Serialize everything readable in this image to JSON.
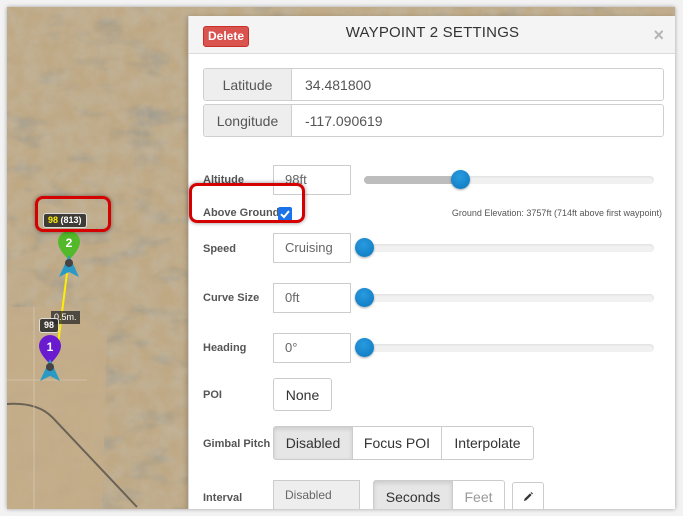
{
  "map": {
    "waypoints": [
      {
        "number": "1",
        "color": "#6a1bd0",
        "label": "98"
      },
      {
        "number": "2",
        "color": "#53b82a",
        "label_alt": "98",
        "label_ground": "(813)"
      }
    ],
    "segment_distance": "0.5m."
  },
  "panel": {
    "title": "WAYPOINT 2 SETTINGS",
    "delete_label": "Delete",
    "close_icon": "×",
    "latitude": {
      "label": "Latitude",
      "value": "34.481800"
    },
    "longitude": {
      "label": "Longitude",
      "value": "-117.090619"
    },
    "altitude": {
      "label": "Altitude",
      "value": "98ft",
      "slider_fraction": 0.33
    },
    "above_ground": {
      "label": "Above Ground",
      "checked": true
    },
    "ground_elevation": "Ground Elevation: 3757ft (714ft above first waypoint)",
    "speed": {
      "label": "Speed",
      "value": "Cruising",
      "slider_fraction": 0.0
    },
    "curve_size": {
      "label": "Curve Size",
      "value": "0ft",
      "slider_fraction": 0.0
    },
    "heading": {
      "label": "Heading",
      "value": "0°",
      "slider_fraction": 0.0
    },
    "poi": {
      "label": "POI",
      "button": "None"
    },
    "gimbal_pitch": {
      "label": "Gimbal Pitch",
      "options": [
        "Disabled",
        "Focus POI",
        "Interpolate"
      ],
      "selected": "Disabled"
    },
    "interval": {
      "label": "Interval",
      "value": "Disabled",
      "units": [
        "Seconds",
        "Feet"
      ],
      "selected_unit": "Seconds",
      "edit_icon": "pencil-icon"
    }
  }
}
